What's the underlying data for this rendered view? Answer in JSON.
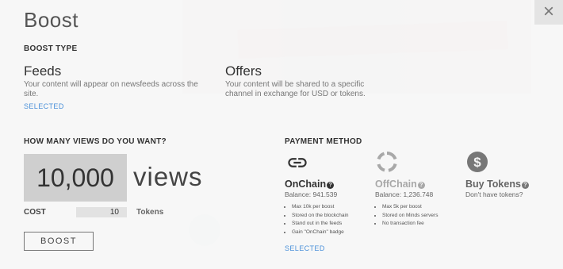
{
  "modal": {
    "title": "Boost",
    "close_glyph": "×",
    "boost_type_label": "BOOST TYPE",
    "types": [
      {
        "name": "Feeds",
        "description": "Your content will appear on newsfeeds across the site.",
        "status": "SELECTED"
      },
      {
        "name": "Offers",
        "description": "Your content will be shared to a specific channel in exchange for USD or tokens."
      }
    ],
    "views_label": "HOW MANY VIEWS DO YOU WANT?",
    "views_value": "10,000",
    "views_unit": "views",
    "cost_label": "COST",
    "cost_value": "10",
    "cost_unit": "Tokens",
    "boost_button": "BOOST",
    "payment_label": "PAYMENT METHOD",
    "payment_methods": [
      {
        "name": "OnChain",
        "icon": "link-icon",
        "balance": "Balance: 941.539",
        "bullets": [
          "Max 10k per boost",
          "Stored on the blockchain",
          "Stand out in the feeds",
          "Gain \"OnChain\" badge"
        ],
        "status": "SELECTED",
        "color": "#333333"
      },
      {
        "name": "OffChain",
        "icon": "offchain-circle-icon",
        "balance": "Balance: 1,236.748",
        "bullets": [
          "Max 5k per boost",
          "Stored on Minds servers",
          "No transaction fee"
        ],
        "color": "#a8a8a8"
      },
      {
        "name": "Buy Tokens",
        "icon": "dollar-icon",
        "subtitle": "Don't have tokens?",
        "color": "#666666"
      }
    ],
    "accent_color": "#4a90d9"
  }
}
